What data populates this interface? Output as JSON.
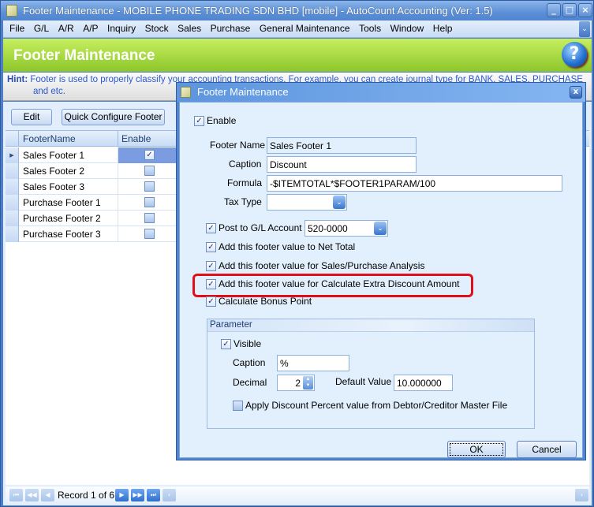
{
  "window": {
    "title": "Footer Maintenance - MOBILE PHONE TRADING SDN BHD [mobile] - AutoCount Accounting (Ver: 1.5)",
    "controls": [
      "minimize",
      "maximize",
      "close"
    ]
  },
  "menu": [
    "File",
    "G/L",
    "A/R",
    "A/P",
    "Inquiry",
    "Stock",
    "Sales",
    "Purchase",
    "General Maintenance",
    "Tools",
    "Window",
    "Help"
  ],
  "header": {
    "title": "Footer Maintenance",
    "help_icon": "?"
  },
  "hint": {
    "label": "Hint:",
    "line1": "Footer is used to properly classify your accounting transactions. For example, you can create journal type for BANK, SALES, PURCHASE",
    "line2": "and etc."
  },
  "toolbar": {
    "edit_label": "Edit",
    "quick_configure_label": "Quick Configure Footer"
  },
  "grid": {
    "columns": [
      "FooterName",
      "Enable"
    ],
    "rows": [
      {
        "name": "Sales Footer 1",
        "enabled": true,
        "selected": true
      },
      {
        "name": "Sales Footer 2",
        "enabled": false
      },
      {
        "name": "Sales Footer 3",
        "enabled": false
      },
      {
        "name": "Purchase Footer 1",
        "enabled": false
      },
      {
        "name": "Purchase Footer 2",
        "enabled": false
      },
      {
        "name": "Purchase Footer 3",
        "enabled": false
      }
    ]
  },
  "navigator": {
    "record_text": "Record 1 of 6"
  },
  "dialog": {
    "title": "Footer Maintenance",
    "enable_label": "Enable",
    "enable_checked": true,
    "footer_name_label": "Footer Name",
    "footer_name_value": "Sales Footer 1",
    "caption_label": "Caption",
    "caption_value": "Discount",
    "formula_label": "Formula",
    "formula_value": "-$ITEMTOTAL*$FOOTER1PARAM/100",
    "tax_type_label": "Tax Type",
    "tax_type_value": "",
    "post_gl_label": "Post to G/L Account",
    "post_gl_value": "520-0000",
    "net_total_label": "Add this footer value to Net Total",
    "analysis_label": "Add this footer value for Sales/Purchase Analysis",
    "extra_discount_label": "Add this footer value for Calculate Extra Discount Amount",
    "bonus_label": "Calculate Bonus Point",
    "parameter": {
      "title": "Parameter",
      "visible_label": "Visible",
      "caption_label": "Caption",
      "caption_value": "%",
      "decimal_label": "Decimal",
      "decimal_value": "2",
      "default_value_label": "Default Value",
      "default_value": "10.000000",
      "apply_discount_label": "Apply Discount Percent value from Debtor/Creditor Master File",
      "apply_discount_checked": false
    },
    "ok_label": "OK",
    "cancel_label": "Cancel"
  },
  "colors": {
    "highlight": "#e0101a",
    "header_green": "#9ed23a",
    "title_blue": "#5c8fd6"
  }
}
